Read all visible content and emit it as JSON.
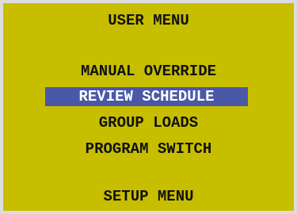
{
  "title": "USER MENU",
  "menu": {
    "items": [
      {
        "label": "MANUAL OVERRIDE",
        "selected": false
      },
      {
        "label": "REVIEW SCHEDULE",
        "selected": true
      },
      {
        "label": "GROUP LOADS",
        "selected": false
      },
      {
        "label": "PROGRAM SWITCH",
        "selected": false
      }
    ]
  },
  "footer": {
    "label": "SETUP MENU"
  },
  "colors": {
    "background": "#c8be00",
    "text": "#111111",
    "highlight": "#4a58a6",
    "highlight_text": "#ffffff",
    "border": "#dcdcdc"
  }
}
